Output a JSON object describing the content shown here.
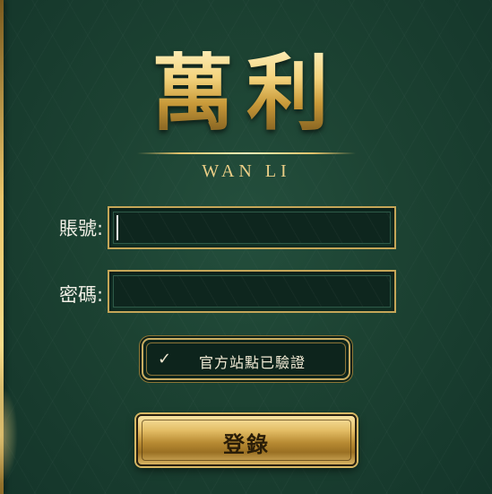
{
  "brand": {
    "title": "萬利",
    "subtitle": "WAN LI"
  },
  "form": {
    "account_label": "賬號:",
    "account_value": "",
    "password_label": "密碼:",
    "password_value": ""
  },
  "verified": {
    "icon": "check-icon",
    "label": "官方站點已驗證"
  },
  "login": {
    "label": "登錄"
  },
  "colors": {
    "background": "#1c4232",
    "gold": "#c9ad62",
    "button_gold": "#e3bd65"
  }
}
